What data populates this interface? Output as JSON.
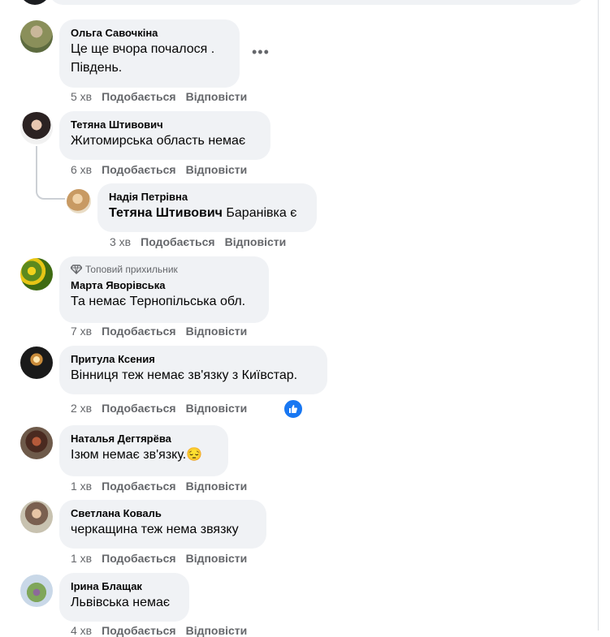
{
  "actions": {
    "like": "Подобається",
    "reply": "Відповісти"
  },
  "comments": [
    {
      "author": "Ольга Савочкіна",
      "text_lines": [
        "Це ще вчора почалося .",
        "Південь."
      ],
      "time": "5 хв",
      "more": "•••"
    },
    {
      "author": "Тетяна Штивович",
      "text": "Житомирська область немає",
      "time": "6 хв"
    },
    {
      "author": "Надія Петрівна",
      "mention": "Тетяна Штивович",
      "text": "Баранівка є",
      "time": "3 хв"
    },
    {
      "badge": "Топовий прихильник",
      "author": "Марта Яворівська",
      "text": "Та немає Тернопільська обл.",
      "time": "7 хв"
    },
    {
      "author": "Притула Ксения",
      "text": "Вінниця теж немає зв'язку з Київстар.",
      "time": "2 хв"
    },
    {
      "author": "Наталья Дегтярёва",
      "text": "Ізюм немає зв'язку.",
      "emoji": "😔",
      "time": "1 хв"
    },
    {
      "author": "Светлана Коваль",
      "text": "черкащина теж нема звязку",
      "time": "1 хв"
    },
    {
      "author": "Ірина Блащак",
      "text": "Львівська немає",
      "time": "4 хв"
    }
  ],
  "colors": {
    "bubble": "#f0f2f5",
    "meta": "#65676b",
    "like_blue": "#1877f2"
  }
}
